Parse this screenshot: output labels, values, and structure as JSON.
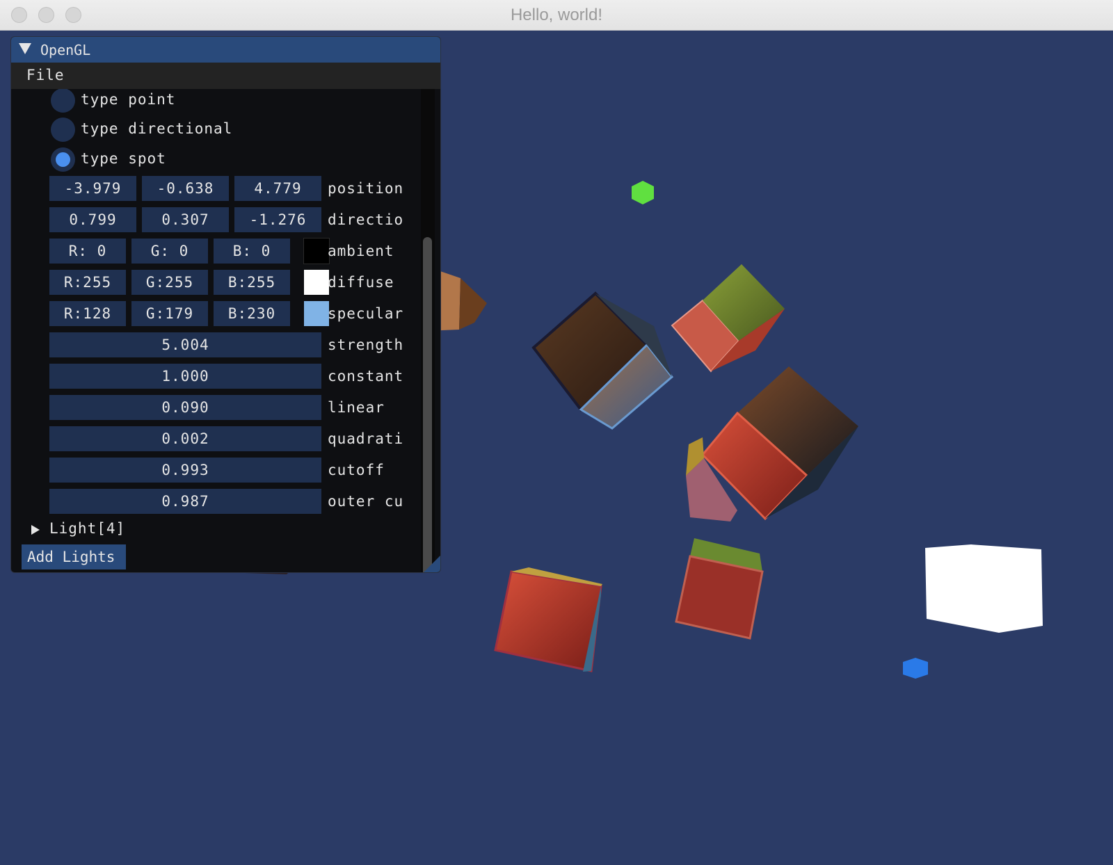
{
  "window": {
    "title": "Hello, world!"
  },
  "colors": {
    "viewport_bg": "#2b3b66",
    "panel_bg": "#0e0f12",
    "accent": "#294a7b",
    "field_bg": "#1f3050",
    "radio_active": "#4a90f0"
  },
  "panel": {
    "title": "OpenGL",
    "menu": [
      "File"
    ],
    "light_types": [
      {
        "label": "type point",
        "selected": false
      },
      {
        "label": "type directional",
        "selected": false
      },
      {
        "label": "type spot",
        "selected": true
      }
    ],
    "position": {
      "values": [
        "-3.979",
        "-0.638",
        "4.779"
      ],
      "label": "position"
    },
    "direction": {
      "values": [
        "0.799",
        "0.307",
        "-1.276"
      ],
      "label": "directio"
    },
    "ambient": {
      "r": "R:  0",
      "g": "G:  0",
      "b": "B:  0",
      "label": "ambient",
      "color": "#000000"
    },
    "diffuse": {
      "r": "R:255",
      "g": "G:255",
      "b": "B:255",
      "label": "diffuse",
      "color": "#ffffff"
    },
    "specular": {
      "r": "R:128",
      "g": "G:179",
      "b": "B:230",
      "label": "specular",
      "color": "#80b3e6"
    },
    "sliders": [
      {
        "value": "5.004",
        "label": "strength"
      },
      {
        "value": "1.000",
        "label": "constant"
      },
      {
        "value": "0.090",
        "label": "linear"
      },
      {
        "value": "0.002",
        "label": "quadrati"
      },
      {
        "value": "0.993",
        "label": "cutoff"
      },
      {
        "value": "0.987",
        "label": "outer cu"
      }
    ],
    "collapsed_node": "Light[4]",
    "add_button": "Add Lights"
  },
  "scene": {
    "objects": [
      "green-light-cube",
      "blue-light-cube",
      "white-light-cube",
      "wooden-crates"
    ]
  }
}
